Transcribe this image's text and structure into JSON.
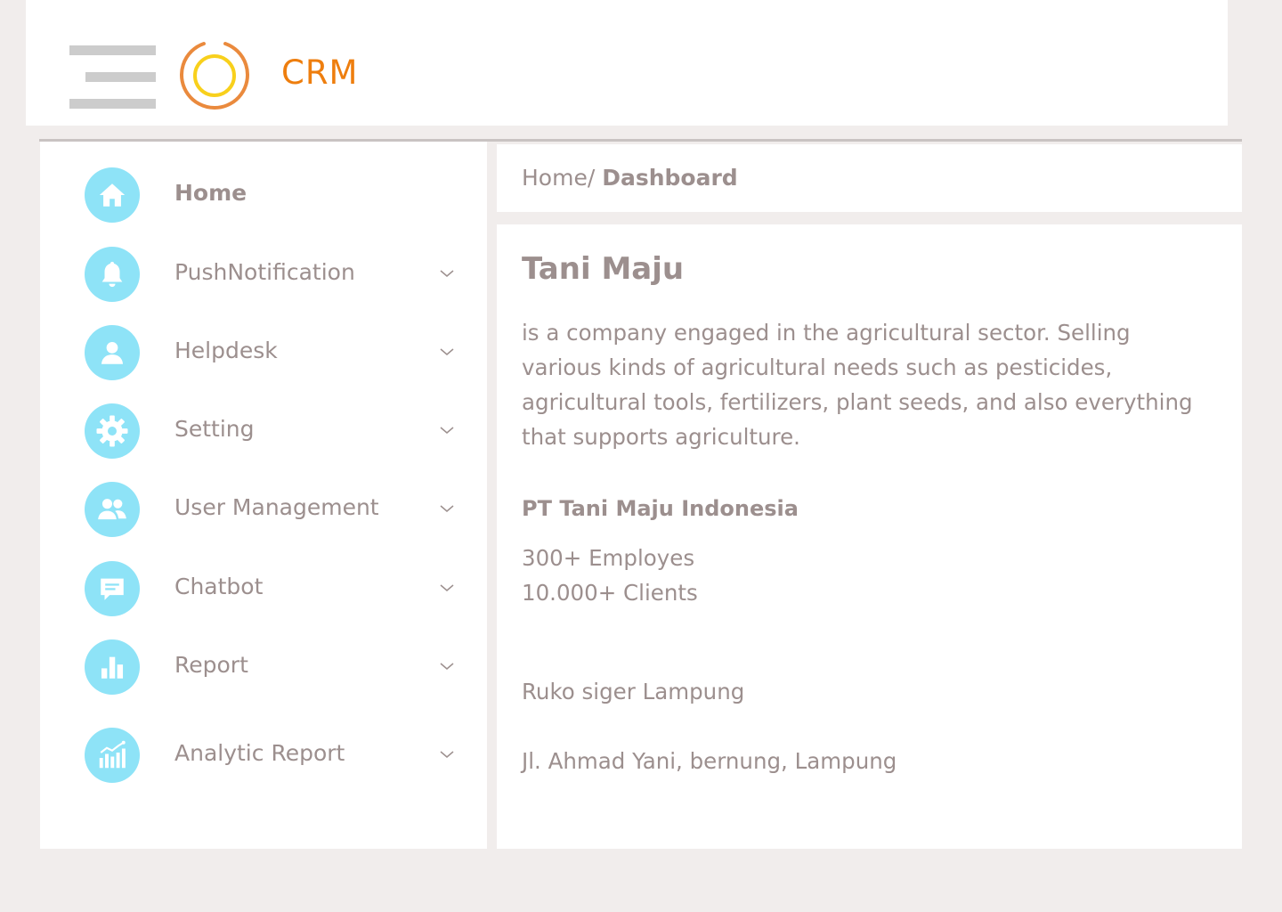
{
  "header": {
    "brand": "CRM",
    "menu_icon": "hamburger-icon",
    "logo_icon": "ring-logo-icon",
    "colors": {
      "brand": "#ee7e0e",
      "logo_outer": "#ea8a3d",
      "logo_inner": "#f8d01c"
    }
  },
  "sidebar": {
    "accent": "#8ee3f7",
    "items": [
      {
        "label": "Home",
        "icon": "home-icon",
        "active": true,
        "has_submenu": false
      },
      {
        "label": "PushNotification",
        "icon": "bell-icon",
        "has_submenu": true
      },
      {
        "label": "Helpdesk",
        "icon": "user-icon",
        "has_submenu": true
      },
      {
        "label": "Setting",
        "icon": "gear-icon",
        "has_submenu": true
      },
      {
        "label": "User Management",
        "icon": "users-icon",
        "has_submenu": true
      },
      {
        "label": "Chatbot",
        "icon": "chat-icon",
        "has_submenu": true
      },
      {
        "label": "Report",
        "icon": "bar-chart-icon",
        "has_submenu": true
      },
      {
        "label": "Analytic Report",
        "icon": "analytics-icon",
        "has_submenu": true
      }
    ]
  },
  "breadcrumb": {
    "parent": "Home/",
    "current": "Dashboard"
  },
  "content": {
    "title": "Tani Maju",
    "description": "is a company engaged in the agricultural sector. Selling various kinds of agricultural needs such as pesticides, agricultural tools, fertilizers, plant seeds, and also everything that supports agriculture.",
    "company": "PT Tani Maju Indonesia",
    "employees": "300+ Employes",
    "clients": "10.000+ Clients",
    "address_line1": "Ruko siger Lampung",
    "address_line2": "Jl. Ahmad Yani, bernung, Lampung"
  }
}
